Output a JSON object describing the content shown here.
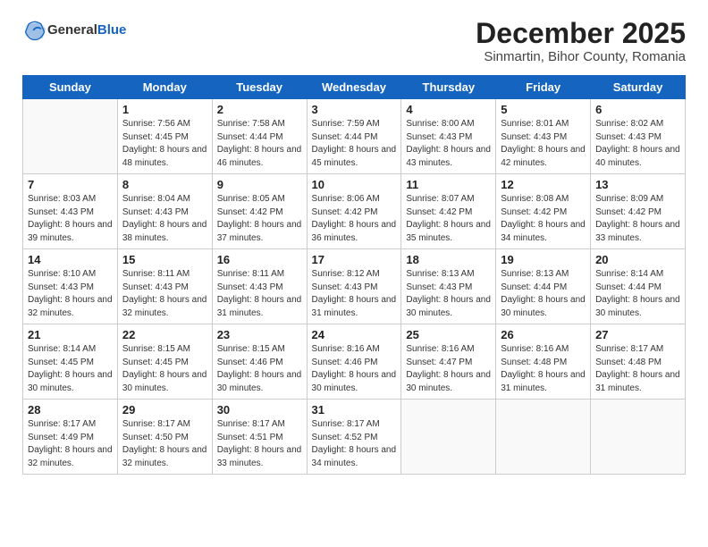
{
  "header": {
    "logo_general": "General",
    "logo_blue": "Blue",
    "month_title": "December 2025",
    "location": "Sinmartin, Bihor County, Romania"
  },
  "weekdays": [
    "Sunday",
    "Monday",
    "Tuesday",
    "Wednesday",
    "Thursday",
    "Friday",
    "Saturday"
  ],
  "weeks": [
    [
      {
        "day": "",
        "sunrise": "",
        "sunset": "",
        "daylight": ""
      },
      {
        "day": "1",
        "sunrise": "Sunrise: 7:56 AM",
        "sunset": "Sunset: 4:45 PM",
        "daylight": "Daylight: 8 hours and 48 minutes."
      },
      {
        "day": "2",
        "sunrise": "Sunrise: 7:58 AM",
        "sunset": "Sunset: 4:44 PM",
        "daylight": "Daylight: 8 hours and 46 minutes."
      },
      {
        "day": "3",
        "sunrise": "Sunrise: 7:59 AM",
        "sunset": "Sunset: 4:44 PM",
        "daylight": "Daylight: 8 hours and 45 minutes."
      },
      {
        "day": "4",
        "sunrise": "Sunrise: 8:00 AM",
        "sunset": "Sunset: 4:43 PM",
        "daylight": "Daylight: 8 hours and 43 minutes."
      },
      {
        "day": "5",
        "sunrise": "Sunrise: 8:01 AM",
        "sunset": "Sunset: 4:43 PM",
        "daylight": "Daylight: 8 hours and 42 minutes."
      },
      {
        "day": "6",
        "sunrise": "Sunrise: 8:02 AM",
        "sunset": "Sunset: 4:43 PM",
        "daylight": "Daylight: 8 hours and 40 minutes."
      }
    ],
    [
      {
        "day": "7",
        "sunrise": "Sunrise: 8:03 AM",
        "sunset": "Sunset: 4:43 PM",
        "daylight": "Daylight: 8 hours and 39 minutes."
      },
      {
        "day": "8",
        "sunrise": "Sunrise: 8:04 AM",
        "sunset": "Sunset: 4:43 PM",
        "daylight": "Daylight: 8 hours and 38 minutes."
      },
      {
        "day": "9",
        "sunrise": "Sunrise: 8:05 AM",
        "sunset": "Sunset: 4:42 PM",
        "daylight": "Daylight: 8 hours and 37 minutes."
      },
      {
        "day": "10",
        "sunrise": "Sunrise: 8:06 AM",
        "sunset": "Sunset: 4:42 PM",
        "daylight": "Daylight: 8 hours and 36 minutes."
      },
      {
        "day": "11",
        "sunrise": "Sunrise: 8:07 AM",
        "sunset": "Sunset: 4:42 PM",
        "daylight": "Daylight: 8 hours and 35 minutes."
      },
      {
        "day": "12",
        "sunrise": "Sunrise: 8:08 AM",
        "sunset": "Sunset: 4:42 PM",
        "daylight": "Daylight: 8 hours and 34 minutes."
      },
      {
        "day": "13",
        "sunrise": "Sunrise: 8:09 AM",
        "sunset": "Sunset: 4:42 PM",
        "daylight": "Daylight: 8 hours and 33 minutes."
      }
    ],
    [
      {
        "day": "14",
        "sunrise": "Sunrise: 8:10 AM",
        "sunset": "Sunset: 4:43 PM",
        "daylight": "Daylight: 8 hours and 32 minutes."
      },
      {
        "day": "15",
        "sunrise": "Sunrise: 8:11 AM",
        "sunset": "Sunset: 4:43 PM",
        "daylight": "Daylight: 8 hours and 32 minutes."
      },
      {
        "day": "16",
        "sunrise": "Sunrise: 8:11 AM",
        "sunset": "Sunset: 4:43 PM",
        "daylight": "Daylight: 8 hours and 31 minutes."
      },
      {
        "day": "17",
        "sunrise": "Sunrise: 8:12 AM",
        "sunset": "Sunset: 4:43 PM",
        "daylight": "Daylight: 8 hours and 31 minutes."
      },
      {
        "day": "18",
        "sunrise": "Sunrise: 8:13 AM",
        "sunset": "Sunset: 4:43 PM",
        "daylight": "Daylight: 8 hours and 30 minutes."
      },
      {
        "day": "19",
        "sunrise": "Sunrise: 8:13 AM",
        "sunset": "Sunset: 4:44 PM",
        "daylight": "Daylight: 8 hours and 30 minutes."
      },
      {
        "day": "20",
        "sunrise": "Sunrise: 8:14 AM",
        "sunset": "Sunset: 4:44 PM",
        "daylight": "Daylight: 8 hours and 30 minutes."
      }
    ],
    [
      {
        "day": "21",
        "sunrise": "Sunrise: 8:14 AM",
        "sunset": "Sunset: 4:45 PM",
        "daylight": "Daylight: 8 hours and 30 minutes."
      },
      {
        "day": "22",
        "sunrise": "Sunrise: 8:15 AM",
        "sunset": "Sunset: 4:45 PM",
        "daylight": "Daylight: 8 hours and 30 minutes."
      },
      {
        "day": "23",
        "sunrise": "Sunrise: 8:15 AM",
        "sunset": "Sunset: 4:46 PM",
        "daylight": "Daylight: 8 hours and 30 minutes."
      },
      {
        "day": "24",
        "sunrise": "Sunrise: 8:16 AM",
        "sunset": "Sunset: 4:46 PM",
        "daylight": "Daylight: 8 hours and 30 minutes."
      },
      {
        "day": "25",
        "sunrise": "Sunrise: 8:16 AM",
        "sunset": "Sunset: 4:47 PM",
        "daylight": "Daylight: 8 hours and 30 minutes."
      },
      {
        "day": "26",
        "sunrise": "Sunrise: 8:16 AM",
        "sunset": "Sunset: 4:48 PM",
        "daylight": "Daylight: 8 hours and 31 minutes."
      },
      {
        "day": "27",
        "sunrise": "Sunrise: 8:17 AM",
        "sunset": "Sunset: 4:48 PM",
        "daylight": "Daylight: 8 hours and 31 minutes."
      }
    ],
    [
      {
        "day": "28",
        "sunrise": "Sunrise: 8:17 AM",
        "sunset": "Sunset: 4:49 PM",
        "daylight": "Daylight: 8 hours and 32 minutes."
      },
      {
        "day": "29",
        "sunrise": "Sunrise: 8:17 AM",
        "sunset": "Sunset: 4:50 PM",
        "daylight": "Daylight: 8 hours and 32 minutes."
      },
      {
        "day": "30",
        "sunrise": "Sunrise: 8:17 AM",
        "sunset": "Sunset: 4:51 PM",
        "daylight": "Daylight: 8 hours and 33 minutes."
      },
      {
        "day": "31",
        "sunrise": "Sunrise: 8:17 AM",
        "sunset": "Sunset: 4:52 PM",
        "daylight": "Daylight: 8 hours and 34 minutes."
      },
      {
        "day": "",
        "sunrise": "",
        "sunset": "",
        "daylight": ""
      },
      {
        "day": "",
        "sunrise": "",
        "sunset": "",
        "daylight": ""
      },
      {
        "day": "",
        "sunrise": "",
        "sunset": "",
        "daylight": ""
      }
    ]
  ]
}
